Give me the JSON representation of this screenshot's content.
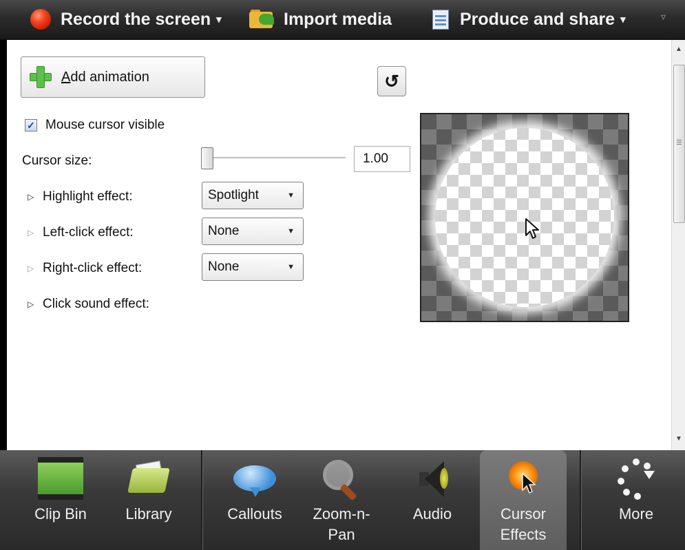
{
  "toolbar": {
    "record_label": "Record the screen",
    "import_label": "Import media",
    "produce_label": "Produce and share",
    "dropdown_arrow": "▾",
    "overflow_icon": "▿"
  },
  "panel": {
    "add_animation_prefix": "A",
    "add_animation_rest": "dd animation",
    "reset_icon": "↺",
    "mouse_cursor_visible_label": "Mouse cursor visible",
    "mouse_cursor_visible_checked": true,
    "cursor_size_label": "Cursor size:",
    "cursor_size_value": "1.00",
    "effects": [
      {
        "label": "Highlight effect:",
        "value": "Spotlight",
        "expanded_marker": "▷"
      },
      {
        "label": "Left-click effect:",
        "value": "None",
        "expanded_marker": "▷"
      },
      {
        "label": "Right-click effect:",
        "value": "None",
        "expanded_marker": "▷"
      },
      {
        "label": "Click sound effect:",
        "expanded_marker": "▷"
      }
    ],
    "checkbox_mark": "✓",
    "caret": "▼",
    "preview_icon": "mouse-pointer-icon"
  },
  "scrollbar": {
    "up": "▲",
    "down": "▼"
  },
  "tabs": [
    {
      "label": "Clip Bin",
      "icon": "film-strip-icon"
    },
    {
      "label": "Library",
      "icon": "library-folder-icon"
    },
    {
      "label": "Callouts",
      "icon": "speech-bubble-icon"
    },
    {
      "label": "Zoom-n-\nPan",
      "line1": "Zoom-n-",
      "line2": "Pan",
      "icon": "magnifier-icon"
    },
    {
      "label": "Audio",
      "icon": "speaker-icon"
    },
    {
      "label": "Cursor\nEffects",
      "line1": "Cursor",
      "line2": "Effects",
      "icon": "cursor-effects-icon",
      "active": true
    },
    {
      "label": "More",
      "icon": "more-dots-icon"
    }
  ],
  "colors": {
    "toolbar_bg": "#2b2b2b",
    "accent_green": "#5cc14a",
    "record_red": "#f3451d"
  }
}
